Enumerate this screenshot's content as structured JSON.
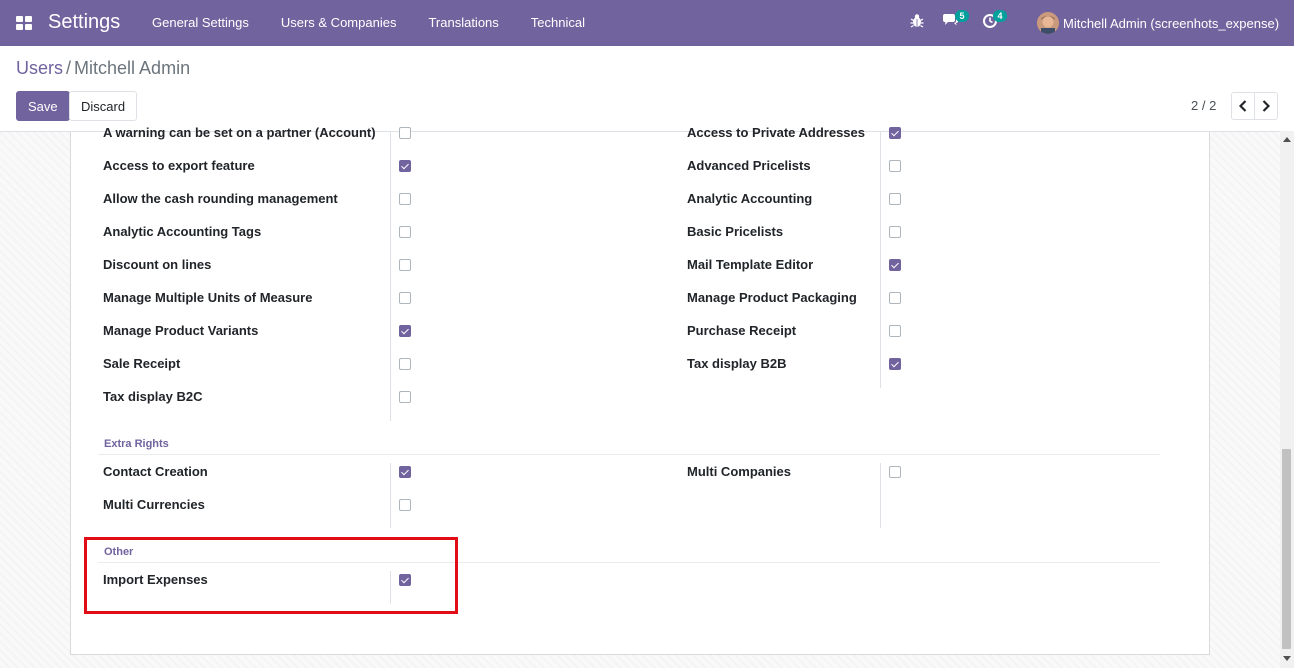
{
  "navbar": {
    "brand": "Settings",
    "menu": [
      "General Settings",
      "Users & Companies",
      "Translations",
      "Technical"
    ],
    "messages_badge": "5",
    "activities_badge": "4",
    "user_name": "Mitchell Admin (screenhots_expense)"
  },
  "breadcrumb": {
    "parent": "Users",
    "separator": "/",
    "current": "Mitchell Admin"
  },
  "buttons": {
    "save": "Save",
    "discard": "Discard"
  },
  "pager": {
    "value": "2 / 2"
  },
  "rights": [
    {
      "label": "A warning can be set on a partner (Account)",
      "checked": false,
      "col": 0
    },
    {
      "label": "Access to Private Addresses",
      "checked": true,
      "col": 1
    },
    {
      "label": "Access to export feature",
      "checked": true,
      "col": 0
    },
    {
      "label": "Advanced Pricelists",
      "checked": false,
      "col": 1
    },
    {
      "label": "Allow the cash rounding management",
      "checked": false,
      "col": 0
    },
    {
      "label": "Analytic Accounting",
      "checked": false,
      "col": 1
    },
    {
      "label": "Analytic Accounting Tags",
      "checked": false,
      "col": 0
    },
    {
      "label": "Basic Pricelists",
      "checked": false,
      "col": 1
    },
    {
      "label": "Discount on lines",
      "checked": false,
      "col": 0
    },
    {
      "label": "Mail Template Editor",
      "checked": true,
      "col": 1
    },
    {
      "label": "Manage Multiple Units of Measure",
      "checked": false,
      "col": 0
    },
    {
      "label": "Manage Product Packaging",
      "checked": false,
      "col": 1
    },
    {
      "label": "Manage Product Variants",
      "checked": true,
      "col": 0
    },
    {
      "label": "Purchase Receipt",
      "checked": false,
      "col": 1
    },
    {
      "label": "Sale Receipt",
      "checked": false,
      "col": 0
    },
    {
      "label": "Tax display B2B",
      "checked": true,
      "col": 1
    },
    {
      "label": "Tax display B2C",
      "checked": false,
      "col": 0
    }
  ],
  "extra_rights": {
    "title": "Extra Rights",
    "items": [
      {
        "label": "Contact Creation",
        "checked": true
      },
      {
        "label": "Multi Companies",
        "checked": false
      },
      {
        "label": "Multi Currencies",
        "checked": false
      }
    ]
  },
  "other": {
    "title": "Other",
    "items": [
      {
        "label": "Import Expenses",
        "checked": true
      }
    ]
  },
  "colors": {
    "brand": "#71639e",
    "highlight": "#e20c17",
    "badge": "#00a09d"
  }
}
